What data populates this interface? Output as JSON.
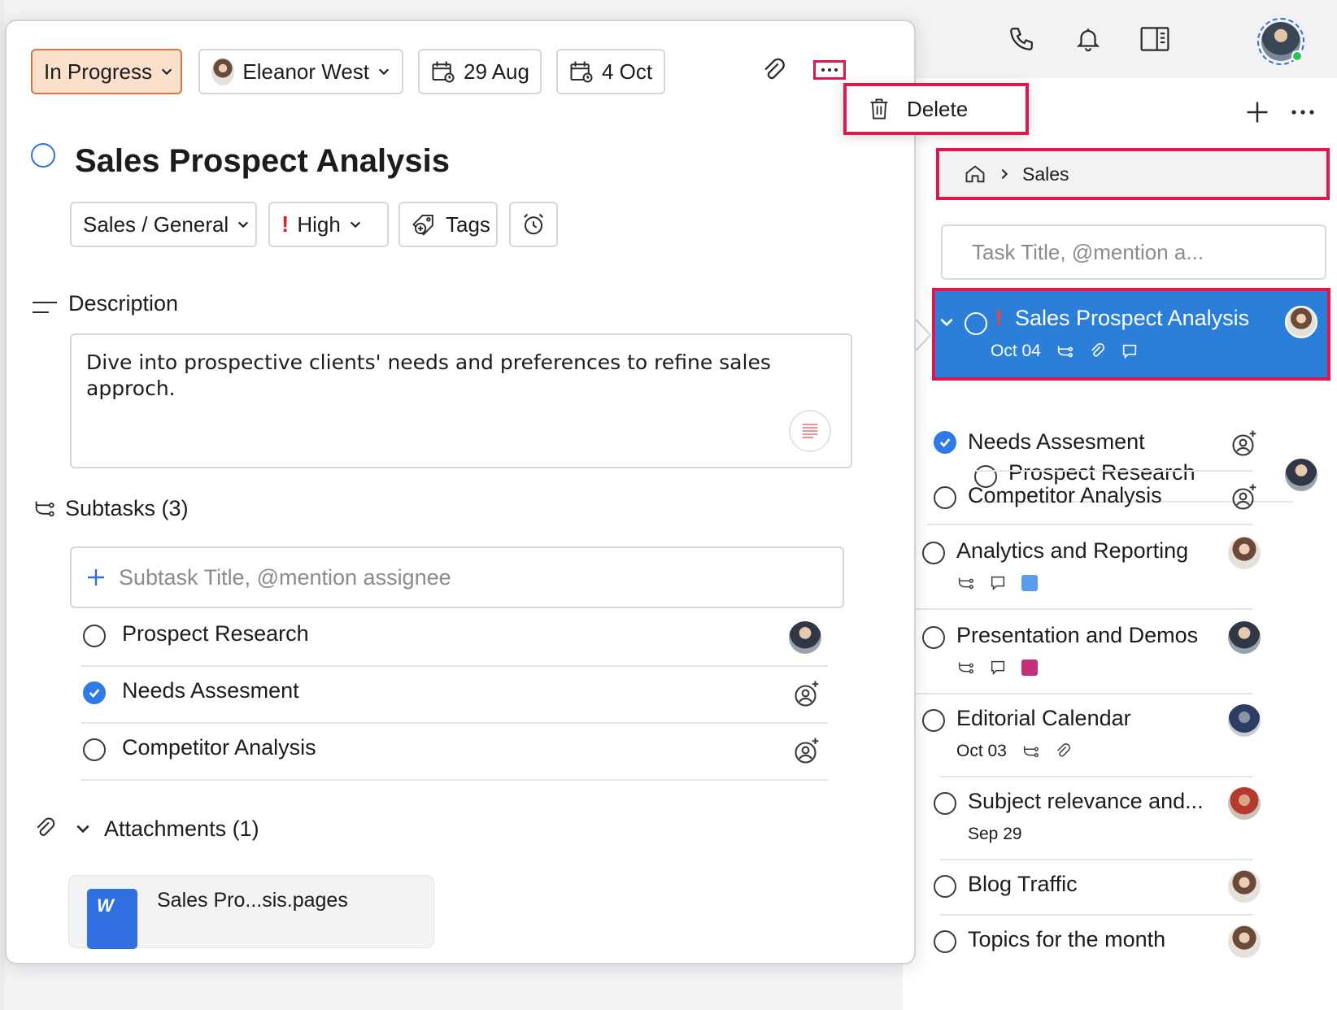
{
  "toolbar": {
    "status": "In Progress",
    "assignee": "Eleanor West",
    "start_date": "29 Aug",
    "due_date": "4 Oct",
    "delete_label": "Delete"
  },
  "task": {
    "title": "Sales Prospect Analysis",
    "list": "Sales / General",
    "priority": "High",
    "tags_label": "Tags"
  },
  "description": {
    "label": "Description",
    "text": "Dive into prospective clients' needs and preferences to refine sales approch."
  },
  "subtasks": {
    "label": "Subtasks (3)",
    "input_placeholder": "Subtask Title, @mention assignee",
    "items": [
      {
        "title": "Prospect Research",
        "done": false
      },
      {
        "title": "Needs Assesment",
        "done": true
      },
      {
        "title": "Competitor Analysis",
        "done": false
      }
    ]
  },
  "attachments": {
    "label": "Attachments (1)",
    "file_name": "Sales Pro...sis.pages",
    "file_icon_text": "W"
  },
  "sidebar": {
    "breadcrumb": "Sales",
    "task_input_placeholder": "Task Title, @mention a...",
    "tasks": [
      {
        "title": "Sales Prospect Analysis",
        "date": "Oct 04",
        "selected": true
      },
      {
        "title": "Prospect Research"
      },
      {
        "title": "Needs Assesment",
        "done": true
      },
      {
        "title": "Competitor Analysis"
      },
      {
        "title": "Analytics and Reporting",
        "tag_color": "#5b9cf0"
      },
      {
        "title": "Presentation and Demos",
        "tag_color": "#c2317a"
      },
      {
        "title": "Editorial Calendar",
        "date": "Oct 03"
      },
      {
        "title": "Subject relevance and...",
        "date": "Sep 29"
      },
      {
        "title": "Blog Traffic"
      },
      {
        "title": "Topics for the month"
      }
    ]
  },
  "colors": {
    "accent": "#2b7fd9",
    "highlight": "#e0174f",
    "status_bg": "#fbe0cc",
    "priority": "#e5202e"
  }
}
